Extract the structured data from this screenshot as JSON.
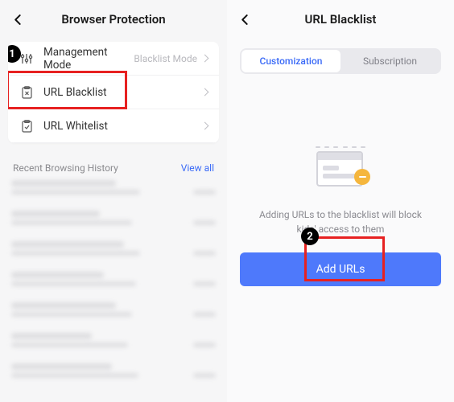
{
  "left": {
    "title": "Browser Protection",
    "rows": {
      "mode": {
        "label": "Management Mode",
        "value": "Blacklist Mode"
      },
      "blacklist": {
        "label": "URL Blacklist"
      },
      "whitelist": {
        "label": "URL Whitelist"
      }
    },
    "history": {
      "title": "Recent Browsing History",
      "viewall": "View all"
    }
  },
  "right": {
    "title": "URL Blacklist",
    "tabs": {
      "customization": "Customization",
      "subscription": "Subscription"
    },
    "emptyText": "Adding URLs to the blacklist will block kids' access to them",
    "cta": "Add URLs"
  },
  "badges": {
    "one": "1",
    "two": "2"
  }
}
